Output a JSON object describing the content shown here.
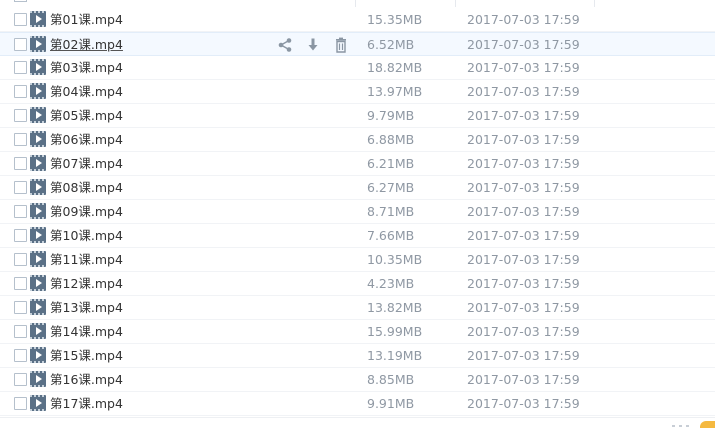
{
  "files": [
    {
      "name": "第01课.mp4",
      "size": "15.35MB",
      "date": "2017-07-03 17:59"
    },
    {
      "name": "第02课.mp4",
      "size": "6.52MB",
      "date": "2017-07-03 17:59"
    },
    {
      "name": "第03课.mp4",
      "size": "18.82MB",
      "date": "2017-07-03 17:59"
    },
    {
      "name": "第04课.mp4",
      "size": "13.97MB",
      "date": "2017-07-03 17:59"
    },
    {
      "name": "第05课.mp4",
      "size": "9.79MB",
      "date": "2017-07-03 17:59"
    },
    {
      "name": "第06课.mp4",
      "size": "6.88MB",
      "date": "2017-07-03 17:59"
    },
    {
      "name": "第07课.mp4",
      "size": "6.21MB",
      "date": "2017-07-03 17:59"
    },
    {
      "name": "第08课.mp4",
      "size": "6.27MB",
      "date": "2017-07-03 17:59"
    },
    {
      "name": "第09课.mp4",
      "size": "8.71MB",
      "date": "2017-07-03 17:59"
    },
    {
      "name": "第10课.mp4",
      "size": "7.66MB",
      "date": "2017-07-03 17:59"
    },
    {
      "name": "第11课.mp4",
      "size": "10.35MB",
      "date": "2017-07-03 17:59"
    },
    {
      "name": "第12课.mp4",
      "size": "4.23MB",
      "date": "2017-07-03 17:59"
    },
    {
      "name": "第13课.mp4",
      "size": "13.82MB",
      "date": "2017-07-03 17:59"
    },
    {
      "name": "第14课.mp4",
      "size": "15.99MB",
      "date": "2017-07-03 17:59"
    },
    {
      "name": "第15课.mp4",
      "size": "13.19MB",
      "date": "2017-07-03 17:59"
    },
    {
      "name": "第16课.mp4",
      "size": "8.85MB",
      "date": "2017-07-03 17:59"
    },
    {
      "name": "第17课.mp4",
      "size": "9.91MB",
      "date": "2017-07-03 17:59"
    }
  ],
  "row_actions": [
    "share-icon",
    "download-icon",
    "delete-icon"
  ],
  "file_icon": "video-file-icon",
  "hovered_row": 1,
  "colors": {
    "text": "#333333",
    "meta_text": "#8f98a3",
    "hover_bg": "#f4f9ff",
    "icon": "#5b7187",
    "action_icon": "#8a96a3",
    "badge": "#f5b940"
  }
}
